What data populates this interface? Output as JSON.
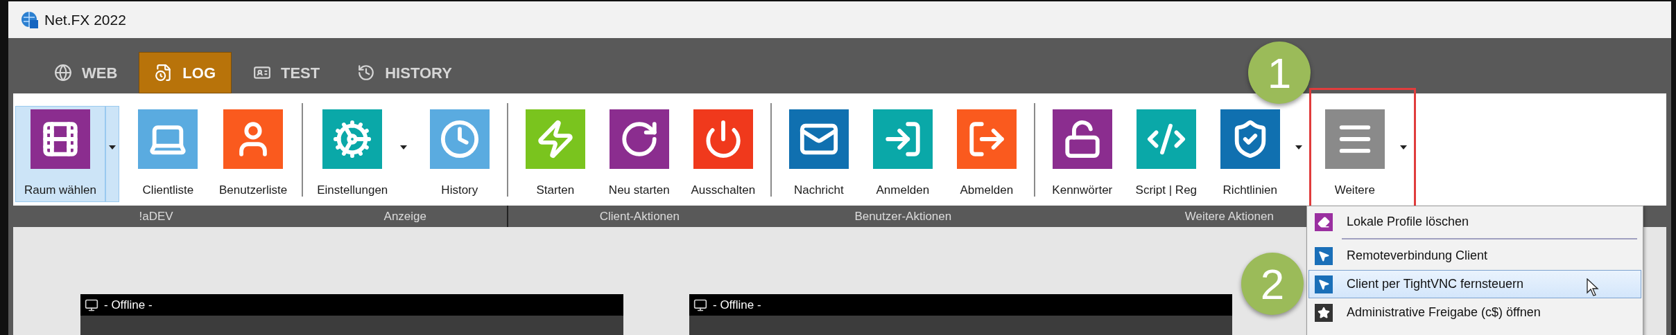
{
  "window": {
    "title": "Net.FX 2022"
  },
  "tabs": [
    {
      "label": "WEB",
      "selected": false
    },
    {
      "label": "LOG",
      "selected": true
    },
    {
      "label": "TEST",
      "selected": false
    },
    {
      "label": "HISTORY",
      "selected": false
    }
  ],
  "ribbon": {
    "groups": [
      {
        "label": "!aDEV",
        "buttons": [
          {
            "label": "Raum wählen",
            "color": "#8b2d8f",
            "selected": true,
            "dropdown": true
          },
          {
            "label": "Clientliste",
            "color": "#5aabe0",
            "selected": false,
            "dropdown": false
          },
          {
            "label": "Benutzerliste",
            "color": "#fa5a1e",
            "selected": false,
            "dropdown": false
          }
        ]
      },
      {
        "label": "Anzeige",
        "buttons": [
          {
            "label": "Einstellungen",
            "color": "#0aa8a8",
            "selected": false,
            "dropdown": true
          },
          {
            "label": "History",
            "color": "#5aabe0",
            "selected": false,
            "dropdown": false
          }
        ]
      },
      {
        "label": "Client-Aktionen",
        "buttons": [
          {
            "label": "Starten",
            "color": "#7ac41e",
            "selected": false,
            "dropdown": false
          },
          {
            "label": "Neu starten",
            "color": "#8b2d8f",
            "selected": false,
            "dropdown": false
          },
          {
            "label": "Ausschalten",
            "color": "#f0391c",
            "selected": false,
            "dropdown": false
          }
        ]
      },
      {
        "label": "Benutzer-Aktionen",
        "buttons": [
          {
            "label": "Nachricht",
            "color": "#1070b0",
            "selected": false,
            "dropdown": false
          },
          {
            "label": "Anmelden",
            "color": "#0aa8a8",
            "selected": false,
            "dropdown": false
          },
          {
            "label": "Abmelden",
            "color": "#fa5a1e",
            "selected": false,
            "dropdown": false
          }
        ]
      },
      {
        "label": "Weitere Aktionen",
        "buttons": [
          {
            "label": "Kennwörter",
            "color": "#8b2d8f",
            "selected": false,
            "dropdown": false
          },
          {
            "label": "Script | Reg",
            "color": "#0aa8a8",
            "selected": false,
            "dropdown": false
          },
          {
            "label": "Richtlinien",
            "color": "#1070b0",
            "selected": false,
            "dropdown": true
          },
          {
            "label": "Weitere",
            "color": "#8a8a8a",
            "selected": false,
            "dropdown": true
          }
        ]
      }
    ]
  },
  "panels": [
    {
      "title": "- Offline -"
    },
    {
      "title": "- Offline -"
    }
  ],
  "menu": {
    "items": [
      {
        "kind": "item",
        "label": "Lokale Profile löschen",
        "color": "#9a2fa0",
        "selected": false
      },
      {
        "kind": "separator"
      },
      {
        "kind": "item",
        "label": "Remoteverbindung Client",
        "color": "#1a6fb8",
        "selected": false
      },
      {
        "kind": "item",
        "label": "Client per TightVNC fernsteuern",
        "color": "#1a6fb8",
        "selected": true
      },
      {
        "kind": "item",
        "label": "Administrative Freigabe (c$) öffnen",
        "color": "#333333",
        "selected": false
      }
    ]
  },
  "annotations": [
    {
      "label": "1"
    },
    {
      "label": "2"
    }
  ]
}
